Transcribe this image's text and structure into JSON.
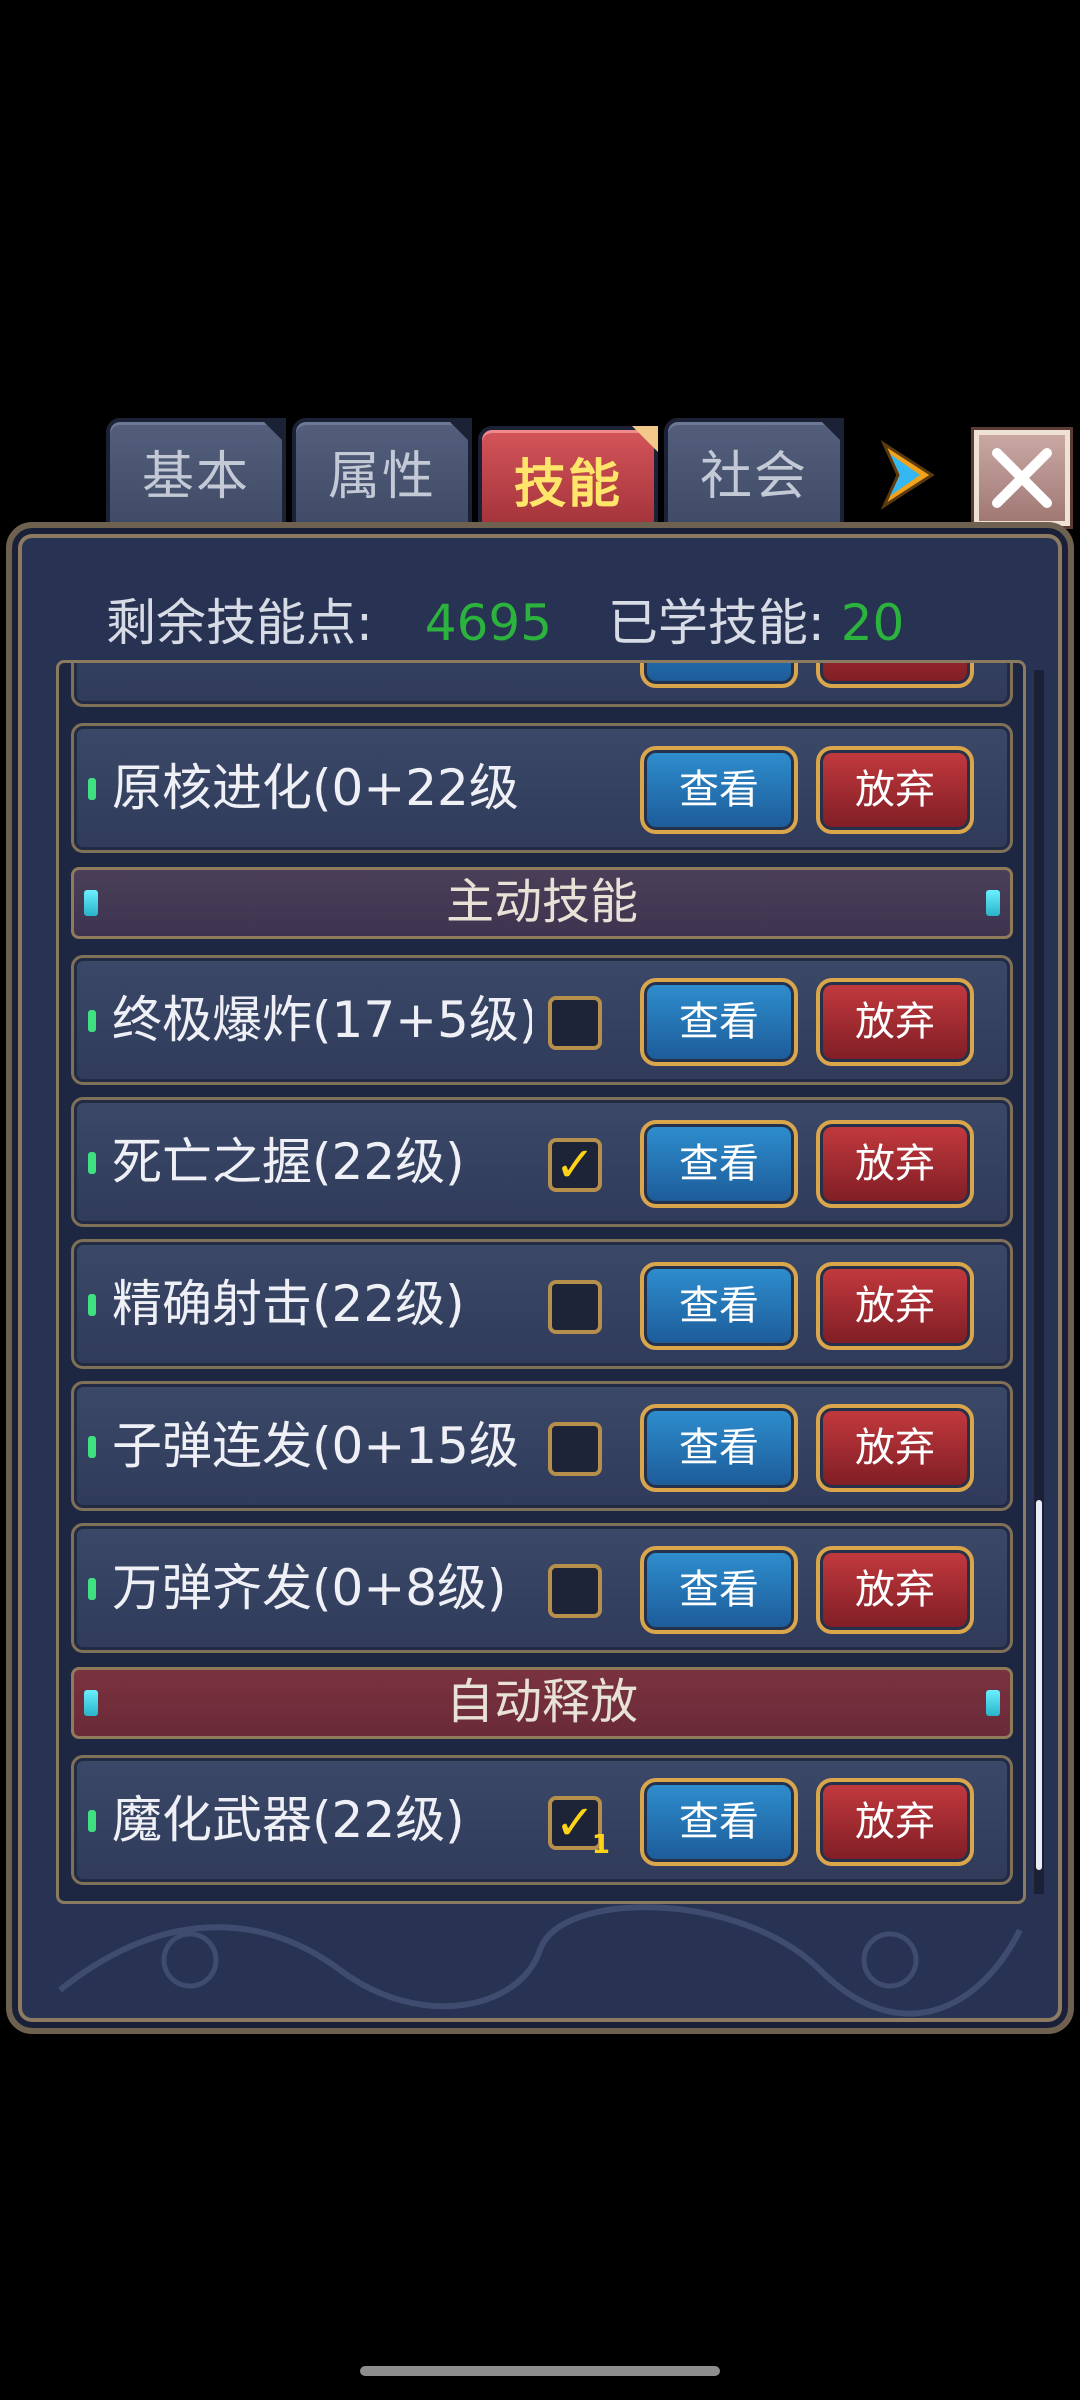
{
  "tabs": [
    {
      "label": "基本",
      "active": false
    },
    {
      "label": "属性",
      "active": false
    },
    {
      "label": "技能",
      "active": true
    },
    {
      "label": "社会",
      "active": false
    }
  ],
  "summary": {
    "points_label": "剩余技能点:",
    "points_value": "4695",
    "learned_label": "已学技能:",
    "learned_value": "20"
  },
  "buttons": {
    "view": "查看",
    "drop": "放弃"
  },
  "sections": {
    "active": "主动技能",
    "auto": "自动释放"
  },
  "skills": [
    {
      "name": "原核进化(0+22级",
      "checkbox": false
    },
    {
      "name": "终极爆炸(17+5级)",
      "checkbox": true,
      "checked": false
    },
    {
      "name": "死亡之握(22级)",
      "checkbox": true,
      "checked": true
    },
    {
      "name": "精确射击(22级)",
      "checkbox": true,
      "checked": false
    },
    {
      "name": "子弹连发(0+15级",
      "checkbox": true,
      "checked": false
    },
    {
      "name": "万弹齐发(0+8级)",
      "checkbox": true,
      "checked": false
    },
    {
      "name": "魔化武器(22级)",
      "checkbox": true,
      "checked": true,
      "badge": "1"
    }
  ],
  "colors": {
    "accent_green": "#2bb33d",
    "active_tab_text": "#ffe66b",
    "check": "#ffd316"
  },
  "icons": {
    "next": "arrow-right-icon",
    "close": "close-icon",
    "check": "checkmark-icon"
  }
}
